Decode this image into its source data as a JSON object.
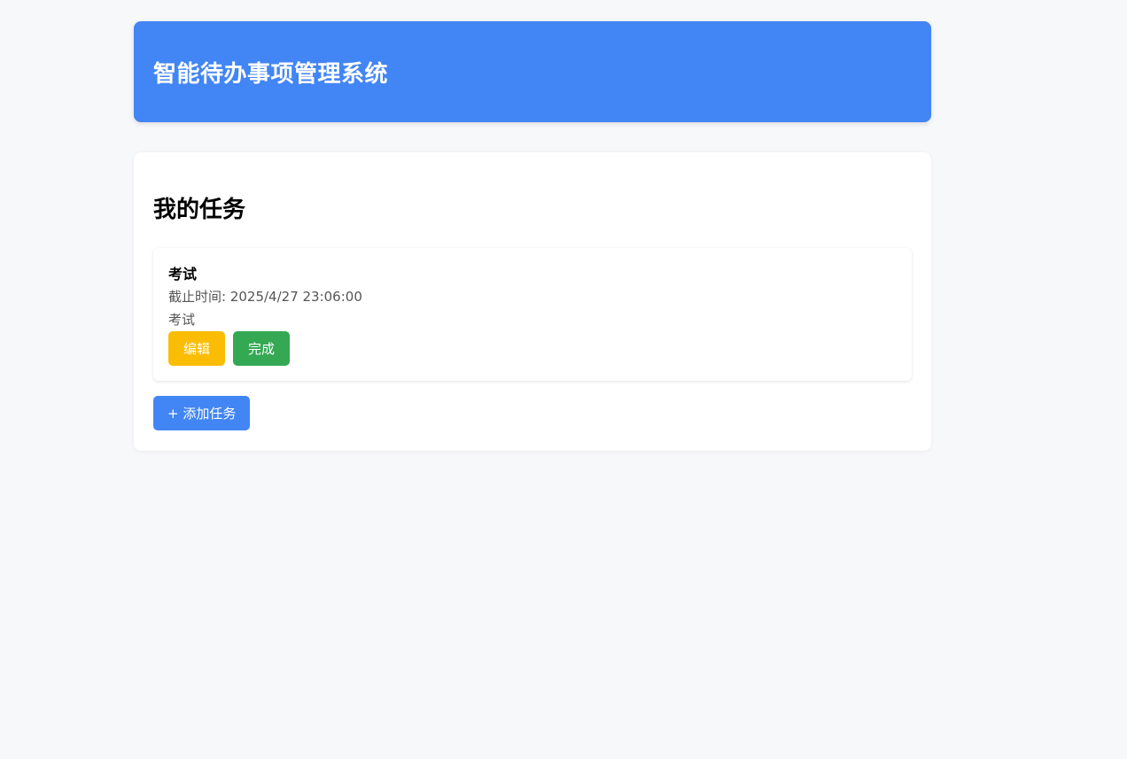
{
  "header": {
    "title": "智能待办事项管理系统"
  },
  "main": {
    "section_title": "我的任务",
    "tasks": [
      {
        "title": "考试",
        "due": "截止时间: 2025/4/27 23:06:00",
        "description": "考试",
        "edit_label": "编辑",
        "complete_label": "完成"
      }
    ],
    "add_button_label": "+ 添加任务"
  },
  "colors": {
    "primary": "#4285f4",
    "edit": "#fbbc04",
    "complete": "#34a853",
    "background": "#f7f8fa"
  }
}
